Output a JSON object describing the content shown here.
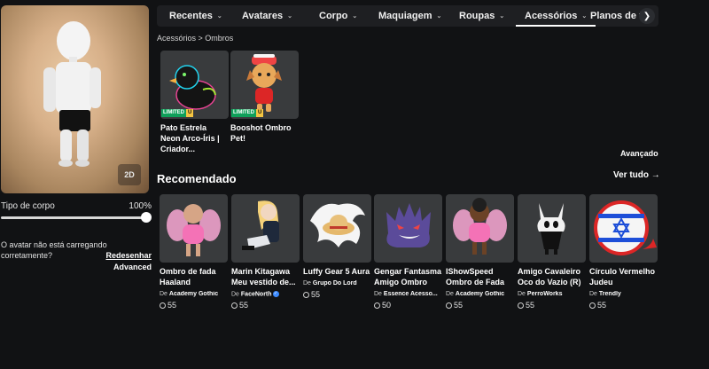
{
  "avatar": {
    "view_toggle": "2D"
  },
  "body_type": {
    "label": "Tipo de corpo",
    "value": "100%",
    "level": 1.0
  },
  "avatar_message": {
    "text": "O avatar não está carregando corretamente?",
    "redraw": "Redesenhar",
    "advanced": "Advanced"
  },
  "nav": {
    "tabs": [
      {
        "label": "Recentes"
      },
      {
        "label": "Avatares"
      },
      {
        "label": "Corpo"
      },
      {
        "label": "Maquiagem"
      },
      {
        "label": "Roupas"
      },
      {
        "label": "Acessórios"
      },
      {
        "label": "Planos de fu"
      }
    ],
    "active": "Acessórios",
    "next_icon": "chevron-right-icon"
  },
  "breadcrumb": {
    "text": "Acessórios > Ombros"
  },
  "owned": [
    {
      "name": "Pato Estrela Neon Arco-Íris | Criador...",
      "badge": "LIMITED",
      "badge2": "U"
    },
    {
      "name": "Booshot Ombro Pet!",
      "badge": "LIMITED",
      "badge2": "U"
    }
  ],
  "advanced_link": "Avançado",
  "recommended": {
    "title": "Recomendado",
    "see_all": "Ver tudo →",
    "creator_prefix": "De",
    "items": [
      {
        "name": "Ombro de fada Haaland",
        "creator": "Academy Gothic",
        "price": "55",
        "verified": false
      },
      {
        "name": "Marin Kitagawa Meu vestido de...",
        "creator": "FaceNorth",
        "price": "55",
        "verified": true
      },
      {
        "name": "Luffy Gear 5 Aura",
        "creator": "Grupo Do Lord",
        "price": "55",
        "verified": false
      },
      {
        "name": "Gengar Fantasma Amigo Ombro",
        "creator": "Essence Acesso...",
        "price": "50",
        "verified": false
      },
      {
        "name": "IShowSpeed Ombro de Fada",
        "creator": "Academy Gothic",
        "price": "55",
        "verified": false
      },
      {
        "name": "Amigo Cavaleiro Oco do Vazio (R)",
        "creator": "PerroWorks",
        "price": "55",
        "verified": false
      },
      {
        "name": "Círculo Vermelho Judeu",
        "creator": "Trendly",
        "price": "55",
        "verified": false
      }
    ]
  },
  "colors": {
    "background": "#111214",
    "nav": "#1e1f22",
    "card": "#393b3d",
    "limited": "#0fa05a",
    "unique": "#f4c542",
    "verified": "#3d8bff"
  }
}
